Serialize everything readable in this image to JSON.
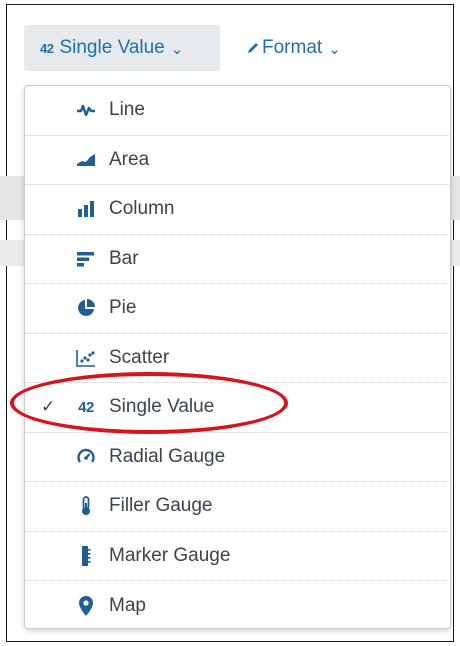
{
  "toolbar": {
    "viz_button": {
      "prefix": "42",
      "label": "Single Value",
      "chevron": "⌄"
    },
    "format_button": {
      "label": "Format",
      "chevron": "⌄"
    }
  },
  "menu": {
    "items": [
      {
        "label": "Line",
        "icon": "line-chart-icon",
        "selected": false
      },
      {
        "label": "Area",
        "icon": "area-chart-icon",
        "selected": false
      },
      {
        "label": "Column",
        "icon": "column-chart-icon",
        "selected": false
      },
      {
        "label": "Bar",
        "icon": "bar-chart-icon",
        "selected": false
      },
      {
        "label": "Pie",
        "icon": "pie-chart-icon",
        "selected": false
      },
      {
        "label": "Scatter",
        "icon": "scatter-chart-icon",
        "selected": false
      },
      {
        "label": "Single Value",
        "icon": "single-value-icon",
        "icon_text": "42",
        "selected": true
      },
      {
        "label": "Radial Gauge",
        "icon": "radial-gauge-icon",
        "selected": false
      },
      {
        "label": "Filler Gauge",
        "icon": "filler-gauge-icon",
        "selected": false
      },
      {
        "label": "Marker Gauge",
        "icon": "marker-gauge-icon",
        "selected": false
      },
      {
        "label": "Map",
        "icon": "map-pin-icon",
        "selected": false
      }
    ],
    "check_glyph": "✓"
  },
  "colors": {
    "accent": "#1f6fb1",
    "icon": "#1f5f96",
    "text": "#3c444d",
    "annotation": "#d8131b"
  }
}
